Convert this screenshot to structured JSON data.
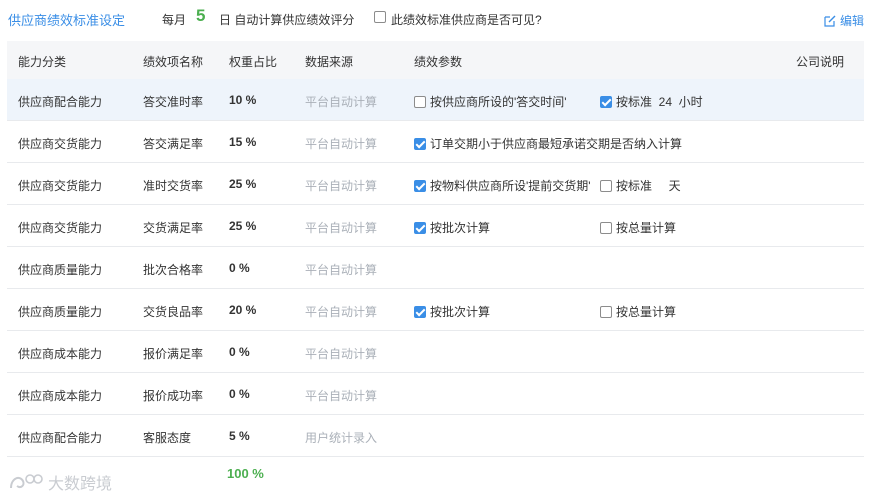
{
  "header": {
    "title": "供应商绩效标准设定",
    "monthly_label": "每月",
    "day_value": "5",
    "day_suffix": "日 自动计算供应绩效评分",
    "visibility_label": "此绩效标准供应商是否可见?",
    "visibility_checked": false,
    "edit_label": "编辑"
  },
  "columns": {
    "category": "能力分类",
    "name": "绩效项名称",
    "weight": "权重占比",
    "source": "数据来源",
    "params": "绩效参数",
    "company_note": "公司说明"
  },
  "rows": [
    {
      "category": "供应商配合能力",
      "name": "答交准时率",
      "weight": "10 %",
      "source": "平台自动计算",
      "params": [
        {
          "checked": false,
          "label": "按供应商所设的'答交时间'"
        },
        {
          "checked": true,
          "label": "按标准  24  小时"
        }
      ]
    },
    {
      "category": "供应商交货能力",
      "name": "答交满足率",
      "weight": "15 %",
      "source": "平台自动计算",
      "params": [
        {
          "checked": true,
          "label": "订单交期小于供应商最短承诺交期是否纳入计算"
        }
      ]
    },
    {
      "category": "供应商交货能力",
      "name": "准时交货率",
      "weight": "25 %",
      "source": "平台自动计算",
      "params": [
        {
          "checked": true,
          "label": "按物料供应商所设'提前交货期'"
        },
        {
          "checked": false,
          "label": "按标准     天"
        }
      ]
    },
    {
      "category": "供应商交货能力",
      "name": "交货满足率",
      "weight": "25 %",
      "source": "平台自动计算",
      "params": [
        {
          "checked": true,
          "label": "按批次计算"
        },
        {
          "checked": false,
          "label": "按总量计算"
        }
      ]
    },
    {
      "category": "供应商质量能力",
      "name": "批次合格率",
      "weight": "0 %",
      "source": "平台自动计算",
      "params": []
    },
    {
      "category": "供应商质量能力",
      "name": "交货良品率",
      "weight": "20 %",
      "source": "平台自动计算",
      "params": [
        {
          "checked": true,
          "label": "按批次计算"
        },
        {
          "checked": false,
          "label": "按总量计算"
        }
      ]
    },
    {
      "category": "供应商成本能力",
      "name": "报价满足率",
      "weight": "0 %",
      "source": "平台自动计算",
      "params": []
    },
    {
      "category": "供应商成本能力",
      "name": "报价成功率",
      "weight": "0 %",
      "source": "平台自动计算",
      "params": []
    },
    {
      "category": "供应商配合能力",
      "name": "客服态度",
      "weight": "5 %",
      "source": "用户统计录入",
      "params": []
    }
  ],
  "total_weight": "100 %",
  "watermark": "大数跨境",
  "colors": {
    "accent": "#3a8ee6",
    "total_green": "#4caf50",
    "source_gray": "#aab0b8",
    "header_bg": "#f5f6f8",
    "highlight_row": "#eef4fb"
  }
}
